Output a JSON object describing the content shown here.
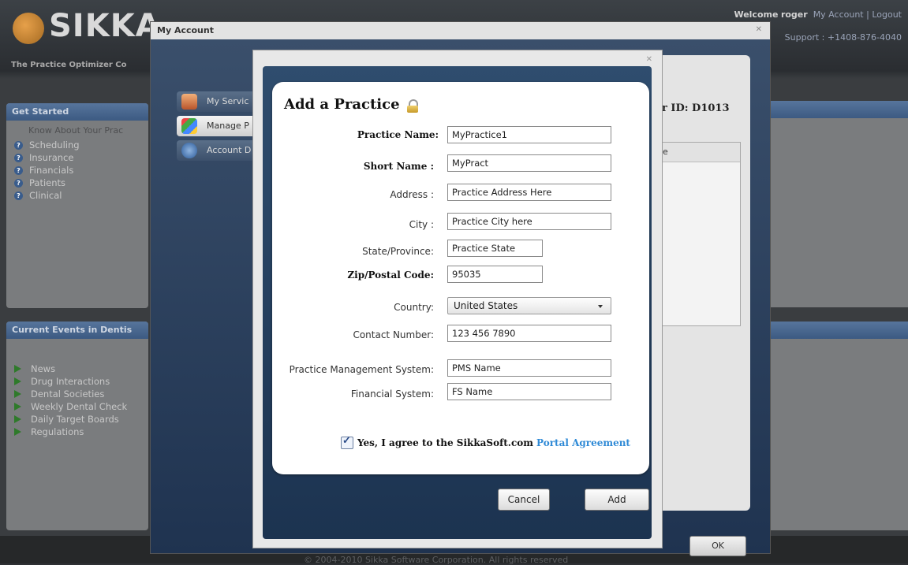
{
  "brand": {
    "logo_text": "SIKKA",
    "tagline": "The Practice Optimizer Co"
  },
  "header": {
    "welcome_prefix": "Welcome",
    "user": "roger",
    "my_account": "My Account",
    "separator": "|",
    "logout": "Logout",
    "support": "Support : +1408-876-4040"
  },
  "get_started": {
    "title": "Get Started",
    "subtitle": "Know About Your Prac",
    "items": [
      "Scheduling",
      "Insurance",
      "Financials",
      "Patients",
      "Clinical"
    ]
  },
  "current_events": {
    "title": "Current Events in Dentis",
    "items": [
      "News",
      "Drug Interactions",
      "Dental Societies",
      "Weekly Dental Check",
      "Daily Target Boards",
      "Regulations"
    ]
  },
  "footer": {
    "copyright": "© 2004-2010 Sikka Software Corporation. All rights reserved"
  },
  "my_account_window": {
    "title": "My Account",
    "close": "✕",
    "nav": [
      "My Servic",
      "Manage P",
      "Account D"
    ],
    "account_id": "r ID: D1013",
    "grid_header": "e",
    "ok_label": "OK"
  },
  "modal": {
    "close": "✕",
    "title": "Add a Practice",
    "fields": {
      "practice_name": {
        "label": "Practice Name:",
        "value": "MyPractice1"
      },
      "short_name": {
        "label": "Short Name :",
        "value": "MyPract"
      },
      "address": {
        "label": "Address :",
        "value": "Practice Address Here"
      },
      "city": {
        "label": "City :",
        "value": "Practice City here"
      },
      "state": {
        "label": "State/Province:",
        "value": "Practice State"
      },
      "zip": {
        "label": "Zip/Postal Code:",
        "value": "95035"
      },
      "country": {
        "label": "Country:",
        "value": "United States"
      },
      "contact": {
        "label": "Contact Number:",
        "value": "123 456 7890"
      },
      "pms": {
        "label": "Practice Management System:",
        "value": "PMS Name"
      },
      "fs": {
        "label": "Financial System:",
        "value": "FS Name"
      }
    },
    "agreement": {
      "checked": true,
      "check_glyph": "✓",
      "text": "Yes, I agree to the SikkaSoft.com",
      "link": "Portal Agreement"
    },
    "cancel_label": "Cancel",
    "add_label": "Add"
  }
}
